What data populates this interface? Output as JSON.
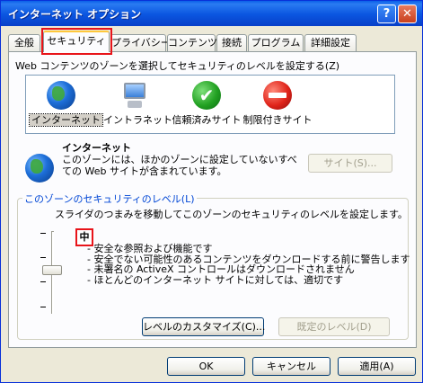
{
  "window": {
    "title": "インターネット オプション",
    "help": "?",
    "close": "✕"
  },
  "tabs": [
    {
      "label": "全般"
    },
    {
      "label": "セキュリティ"
    },
    {
      "label": "プライバシー"
    },
    {
      "label": "コンテンツ"
    },
    {
      "label": "接続"
    },
    {
      "label": "プログラム"
    },
    {
      "label": "詳細設定"
    }
  ],
  "zones_label": "Web コンテンツのゾーンを選択してセキュリティのレベルを設定する(Z)",
  "zones": [
    {
      "label": "インターネット",
      "icon": "globe-icon"
    },
    {
      "label": "イントラネット",
      "icon": "computer-icon"
    },
    {
      "label": "信頼済みサイト",
      "icon": "checkmark-icon"
    },
    {
      "label": "制限付きサイト",
      "icon": "no-entry-icon"
    }
  ],
  "selected_zone": {
    "name": "インターネット",
    "description": "このゾーンには、ほかのゾーンに設定していないすべての Web サイトが含まれています。"
  },
  "sites_button": "サイト(S)...",
  "security_level": {
    "title": "このゾーンのセキュリティのレベル(L)",
    "slider_hint": "スライダのつまみを移動してこのゾーンのセキュリティのレベルを設定します。",
    "level": "中",
    "details": [
      "- 安全な参照および機能です",
      "- 安全でない可能性のあるコンテンツをダウンロードする前に警告します",
      "- 未署名の ActiveX コントロールはダウンロードされません",
      "- ほとんどのインターネット サイトに対しては、適切です"
    ],
    "slider_position": 0.5
  },
  "buttons": {
    "custom_level": "レベルのカスタマイズ(C)...",
    "default_level": "既定のレベル(D)",
    "ok": "OK",
    "cancel": "キャンセル",
    "apply": "適用(A)"
  }
}
